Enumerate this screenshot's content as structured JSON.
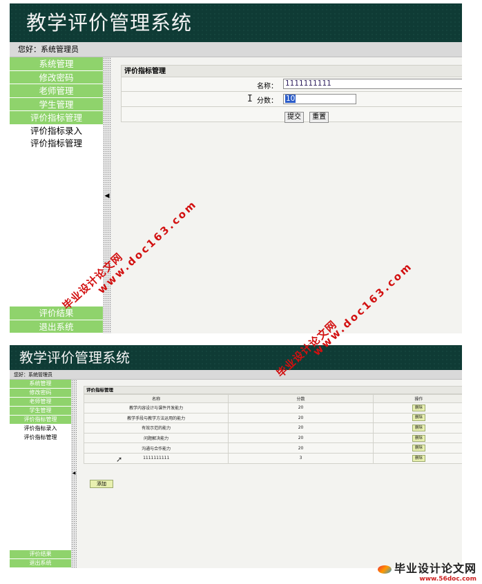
{
  "app_title": "教学评价管理系统",
  "greeting": "您好：系统管理员",
  "menu": [
    "系统管理",
    "修改密码",
    "老师管理",
    "学生管理",
    "评价指标管理"
  ],
  "submenu": [
    "评价指标录入",
    "评价指标管理"
  ],
  "bottom_menu": [
    "评价结果",
    "退出系统"
  ],
  "form": {
    "panel_title": "评价指标管理",
    "name_label": "名称：",
    "name_value": "1111111111",
    "score_label": "分数：",
    "score_value": "10",
    "submit_label": "提交",
    "reset_label": "重置"
  },
  "list": {
    "panel_title": "评价指标管理",
    "columns": [
      "名称",
      "分数",
      "操作"
    ],
    "rows": [
      {
        "name": "教学内容设计与课件开发能力",
        "score": "20",
        "action": "删除"
      },
      {
        "name": "教学手段与教学方法运用的能力",
        "score": "20",
        "action": "删除"
      },
      {
        "name": "有效示范的能力",
        "score": "20",
        "action": "删除"
      },
      {
        "name": "问题解决能力",
        "score": "20",
        "action": "删除"
      },
      {
        "name": "沟通与合作能力",
        "score": "20",
        "action": "删除"
      },
      {
        "name": "1111111111",
        "score": "3",
        "action": "删除"
      }
    ],
    "add_label": "添加"
  },
  "watermark": {
    "site_cn": "毕业设计论文网",
    "url": "www.doc163.com",
    "footer_cn": "毕业设计论文网",
    "footer_url": "www.56doc.com"
  },
  "colors": {
    "banner": "#0f3b35",
    "menu": "#8fd36c",
    "watermark": "#d21010"
  }
}
